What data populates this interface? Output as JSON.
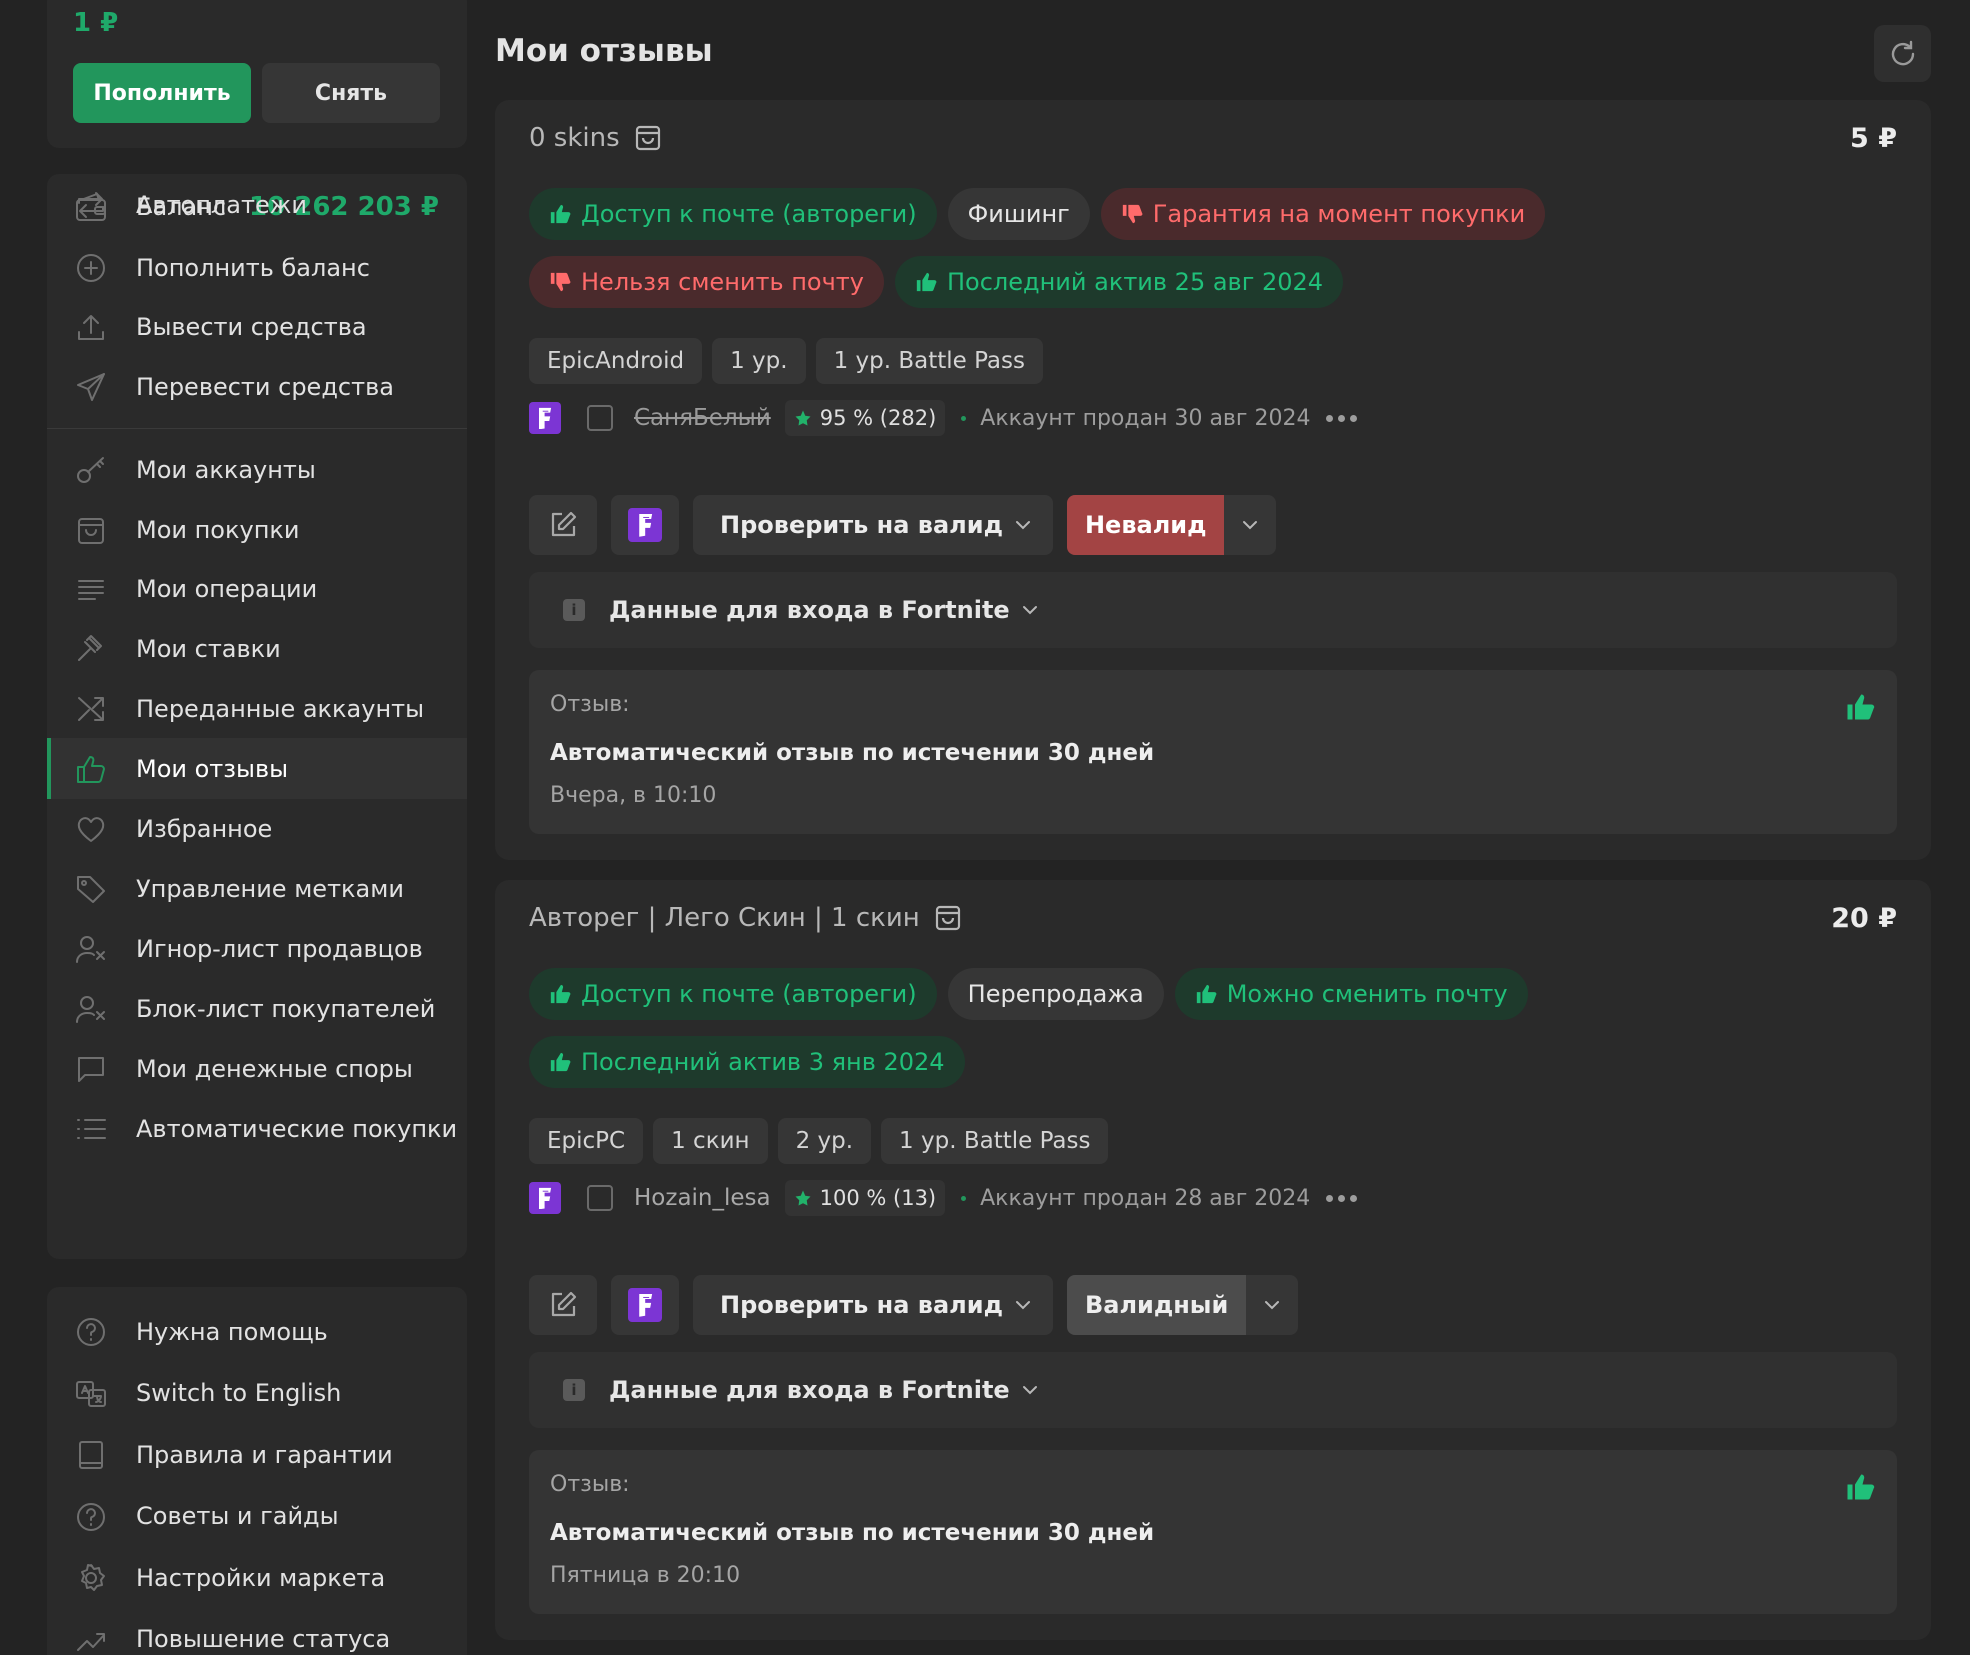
{
  "wallet": {
    "amount": "1 ₽",
    "deposit_label": "Пополнить",
    "withdraw_label": "Снять"
  },
  "menu": {
    "balance": {
      "label": "Баланс",
      "value": "10 262 203 ₽",
      "icon": "wallet-icon"
    },
    "items": [
      {
        "label": "Пополнить баланс",
        "icon": "plus-circle-icon"
      },
      {
        "label": "Вывести средства",
        "icon": "upload-icon"
      },
      {
        "label": "Перевести средства",
        "icon": "send-icon"
      },
      {
        "label": "Мои аккаунты",
        "icon": "key-icon"
      },
      {
        "label": "Мои покупки",
        "icon": "bag-icon"
      },
      {
        "label": "Мои операции",
        "icon": "list-icon"
      },
      {
        "label": "Мои ставки",
        "icon": "gavel-icon"
      },
      {
        "label": "Переданные аккаунты",
        "icon": "shuffle-icon"
      },
      {
        "label": "Мои отзывы",
        "icon": "thumb-up-icon",
        "active": true
      },
      {
        "label": "Избранное",
        "icon": "heart-icon"
      },
      {
        "label": "Управление метками",
        "icon": "tag-icon"
      },
      {
        "label": "Игнор-лист продавцов",
        "icon": "user-x-icon"
      },
      {
        "label": "Блок-лист покупателей",
        "icon": "user-x-icon"
      },
      {
        "label": "Мои денежные споры",
        "icon": "chat-icon"
      },
      {
        "label": "Автоматические покупки",
        "icon": "list-bullets-icon"
      },
      {
        "label": "Автоплатежи",
        "icon": "repeat-icon"
      }
    ]
  },
  "help": {
    "items": [
      {
        "label": "Нужна помощь",
        "icon": "question-icon"
      },
      {
        "label": "Switch to English",
        "icon": "translate-icon"
      },
      {
        "label": "Правила и гарантии",
        "icon": "book-icon"
      },
      {
        "label": "Советы и гайды",
        "icon": "question-icon"
      },
      {
        "label": "Настройки маркета",
        "icon": "gear-icon"
      },
      {
        "label": "Повышение статуса",
        "icon": "trend-up-icon"
      }
    ]
  },
  "page": {
    "title": "Мои отзывы"
  },
  "reviews": [
    {
      "title": "0 skins",
      "price": "5 ₽",
      "tags_row1": [
        {
          "text": "Доступ к почте (автореги)",
          "kind": "good"
        },
        {
          "text": "Фишинг",
          "kind": "neutral"
        },
        {
          "text": "Гарантия на момент покупки",
          "kind": "bad"
        }
      ],
      "tags_row2": [
        {
          "text": "Нельзя сменить почту",
          "kind": "bad"
        },
        {
          "text": "Последний актив 25 авг 2024",
          "kind": "good"
        }
      ],
      "attrs": [
        "EpicAndroid",
        "1 ур.",
        "1 ур. Battle Pass"
      ],
      "seller": "СаняБелый",
      "rating": "95 % (282)",
      "sold": "Аккаунт продан 30 авг 2024",
      "check_label": "Проверить на валид",
      "status": "Невалид",
      "login_label": "Данные для входа в Fortnite",
      "review_label": "Отзыв:",
      "review_text": "Автоматический отзыв по истечении 30 дней",
      "review_date": "Вчера, в 10:10"
    },
    {
      "title": "Авторег | Лего Скин | 1 скин",
      "price": "20 ₽",
      "tags_row1": [
        {
          "text": "Доступ к почте (автореги)",
          "kind": "good"
        },
        {
          "text": "Перепродажа",
          "kind": "neutral"
        },
        {
          "text": "Можно сменить почту",
          "kind": "good"
        }
      ],
      "tags_row2": [
        {
          "text": "Последний актив 3 янв 2024",
          "kind": "good"
        }
      ],
      "attrs": [
        "EpicPC",
        "1 скин",
        "2 ур.",
        "1 ур. Battle Pass"
      ],
      "seller": "Hozain_lesa",
      "rating": "100 % (13)",
      "sold": "Аккаунт продан 28 авг 2024",
      "check_label": "Проверить на валид",
      "status": "Валидный",
      "login_label": "Данные для входа в Fortnite",
      "review_label": "Отзыв:",
      "review_text": "Автоматический отзыв по истечении 30 дней",
      "review_date": "Пятница в 20:10"
    }
  ],
  "colors": {
    "accent": "#22965c",
    "good": "#20c07a",
    "bad": "#ff6b6b",
    "fortnite": "#7c35d4"
  }
}
